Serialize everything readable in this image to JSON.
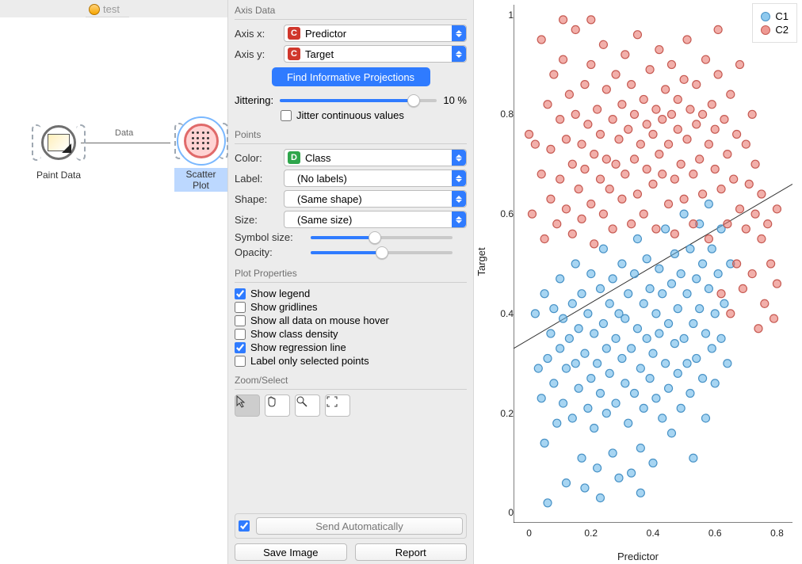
{
  "tab": {
    "title": "test"
  },
  "canvas": {
    "node1_label": "Paint Data",
    "node2_label": "Scatter Plot",
    "edge_label": "Data"
  },
  "panel": {
    "axis_section": "Axis Data",
    "axis_x_label": "Axis x:",
    "axis_x_value": "Predictor",
    "axis_y_label": "Axis y:",
    "axis_y_value": "Target",
    "find_btn": "Find Informative Projections",
    "jitter_label": "Jittering:",
    "jitter_value": "10 %",
    "jitter_cont": "Jitter continuous values",
    "points_section": "Points",
    "color_label": "Color:",
    "color_value": "Class",
    "label_label": "Label:",
    "label_value": "(No labels)",
    "shape_label": "Shape:",
    "shape_value": "(Same shape)",
    "size_label": "Size:",
    "size_value": "(Same size)",
    "symsize_label": "Symbol size:",
    "opacity_label": "Opacity:",
    "plotprops_section": "Plot Properties",
    "p1": "Show legend",
    "p2": "Show gridlines",
    "p3": "Show all data on mouse hover",
    "p4": "Show class density",
    "p5": "Show regression line",
    "p6": "Label only selected points",
    "zoom_section": "Zoom/Select",
    "send_auto": "Send Automatically",
    "save_img": "Save Image",
    "report": "Report"
  },
  "chart_data": {
    "type": "scatter",
    "xlabel": "Predictor",
    "ylabel": "Target",
    "xlim": [
      -0.05,
      0.85
    ],
    "ylim": [
      -0.02,
      1.02
    ],
    "x_ticks": [
      0,
      0.2,
      0.4,
      0.6,
      0.8
    ],
    "y_ticks": [
      0,
      0.2,
      0.4,
      0.6,
      0.8,
      1
    ],
    "legend": [
      "C1",
      "C2"
    ],
    "regression": {
      "x0": -0.05,
      "y0": 0.33,
      "x1": 0.85,
      "y1": 0.66
    },
    "series": [
      {
        "name": "C1",
        "points": [
          [
            0.02,
            0.4
          ],
          [
            0.03,
            0.29
          ],
          [
            0.04,
            0.23
          ],
          [
            0.05,
            0.44
          ],
          [
            0.05,
            0.14
          ],
          [
            0.06,
            0.31
          ],
          [
            0.07,
            0.36
          ],
          [
            0.08,
            0.26
          ],
          [
            0.08,
            0.41
          ],
          [
            0.09,
            0.18
          ],
          [
            0.1,
            0.33
          ],
          [
            0.1,
            0.47
          ],
          [
            0.11,
            0.22
          ],
          [
            0.11,
            0.39
          ],
          [
            0.12,
            0.29
          ],
          [
            0.12,
            0.06
          ],
          [
            0.13,
            0.35
          ],
          [
            0.14,
            0.42
          ],
          [
            0.14,
            0.19
          ],
          [
            0.15,
            0.3
          ],
          [
            0.15,
            0.5
          ],
          [
            0.16,
            0.25
          ],
          [
            0.16,
            0.37
          ],
          [
            0.17,
            0.11
          ],
          [
            0.17,
            0.44
          ],
          [
            0.18,
            0.32
          ],
          [
            0.18,
            0.05
          ],
          [
            0.19,
            0.21
          ],
          [
            0.19,
            0.4
          ],
          [
            0.2,
            0.27
          ],
          [
            0.2,
            0.48
          ],
          [
            0.21,
            0.17
          ],
          [
            0.21,
            0.36
          ],
          [
            0.22,
            0.3
          ],
          [
            0.22,
            0.09
          ],
          [
            0.23,
            0.45
          ],
          [
            0.23,
            0.24
          ],
          [
            0.24,
            0.38
          ],
          [
            0.24,
            0.53
          ],
          [
            0.25,
            0.2
          ],
          [
            0.25,
            0.33
          ],
          [
            0.26,
            0.42
          ],
          [
            0.26,
            0.28
          ],
          [
            0.27,
            0.12
          ],
          [
            0.27,
            0.47
          ],
          [
            0.28,
            0.35
          ],
          [
            0.28,
            0.22
          ],
          [
            0.29,
            0.4
          ],
          [
            0.29,
            0.07
          ],
          [
            0.3,
            0.31
          ],
          [
            0.3,
            0.5
          ],
          [
            0.31,
            0.26
          ],
          [
            0.31,
            0.39
          ],
          [
            0.32,
            0.18
          ],
          [
            0.32,
            0.44
          ],
          [
            0.33,
            0.33
          ],
          [
            0.33,
            0.08
          ],
          [
            0.34,
            0.48
          ],
          [
            0.34,
            0.24
          ],
          [
            0.35,
            0.37
          ],
          [
            0.35,
            0.55
          ],
          [
            0.36,
            0.29
          ],
          [
            0.36,
            0.13
          ],
          [
            0.37,
            0.42
          ],
          [
            0.37,
            0.21
          ],
          [
            0.38,
            0.35
          ],
          [
            0.38,
            0.51
          ],
          [
            0.39,
            0.27
          ],
          [
            0.39,
            0.45
          ],
          [
            0.4,
            0.32
          ],
          [
            0.4,
            0.1
          ],
          [
            0.41,
            0.4
          ],
          [
            0.41,
            0.23
          ],
          [
            0.42,
            0.49
          ],
          [
            0.42,
            0.36
          ],
          [
            0.43,
            0.19
          ],
          [
            0.43,
            0.44
          ],
          [
            0.44,
            0.3
          ],
          [
            0.44,
            0.57
          ],
          [
            0.45,
            0.25
          ],
          [
            0.45,
            0.38
          ],
          [
            0.46,
            0.46
          ],
          [
            0.46,
            0.16
          ],
          [
            0.47,
            0.34
          ],
          [
            0.47,
            0.52
          ],
          [
            0.48,
            0.28
          ],
          [
            0.48,
            0.41
          ],
          [
            0.49,
            0.21
          ],
          [
            0.49,
            0.48
          ],
          [
            0.5,
            0.35
          ],
          [
            0.5,
            0.6
          ],
          [
            0.51,
            0.3
          ],
          [
            0.51,
            0.44
          ],
          [
            0.52,
            0.24
          ],
          [
            0.52,
            0.53
          ],
          [
            0.53,
            0.38
          ],
          [
            0.53,
            0.11
          ],
          [
            0.54,
            0.47
          ],
          [
            0.54,
            0.31
          ],
          [
            0.55,
            0.41
          ],
          [
            0.55,
            0.58
          ],
          [
            0.56,
            0.27
          ],
          [
            0.56,
            0.5
          ],
          [
            0.57,
            0.36
          ],
          [
            0.57,
            0.19
          ],
          [
            0.58,
            0.45
          ],
          [
            0.58,
            0.62
          ],
          [
            0.59,
            0.33
          ],
          [
            0.59,
            0.53
          ],
          [
            0.6,
            0.4
          ],
          [
            0.6,
            0.26
          ],
          [
            0.61,
            0.48
          ],
          [
            0.62,
            0.35
          ],
          [
            0.62,
            0.57
          ],
          [
            0.63,
            0.42
          ],
          [
            0.64,
            0.3
          ],
          [
            0.65,
            0.5
          ],
          [
            0.06,
            0.02
          ],
          [
            0.23,
            0.03
          ],
          [
            0.36,
            0.04
          ]
        ]
      },
      {
        "name": "C2",
        "points": [
          [
            0.0,
            0.76
          ],
          [
            0.01,
            0.6
          ],
          [
            0.02,
            0.74
          ],
          [
            0.04,
            0.68
          ],
          [
            0.04,
            0.95
          ],
          [
            0.05,
            0.55
          ],
          [
            0.06,
            0.82
          ],
          [
            0.07,
            0.63
          ],
          [
            0.07,
            0.73
          ],
          [
            0.08,
            0.88
          ],
          [
            0.09,
            0.58
          ],
          [
            0.1,
            0.79
          ],
          [
            0.1,
            0.67
          ],
          [
            0.11,
            0.91
          ],
          [
            0.12,
            0.61
          ],
          [
            0.12,
            0.75
          ],
          [
            0.13,
            0.84
          ],
          [
            0.14,
            0.56
          ],
          [
            0.14,
            0.7
          ],
          [
            0.15,
            0.8
          ],
          [
            0.15,
            0.97
          ],
          [
            0.16,
            0.65
          ],
          [
            0.17,
            0.74
          ],
          [
            0.17,
            0.59
          ],
          [
            0.18,
            0.86
          ],
          [
            0.18,
            0.69
          ],
          [
            0.19,
            0.78
          ],
          [
            0.2,
            0.62
          ],
          [
            0.2,
            0.9
          ],
          [
            0.21,
            0.72
          ],
          [
            0.21,
            0.54
          ],
          [
            0.22,
            0.81
          ],
          [
            0.23,
            0.67
          ],
          [
            0.23,
            0.76
          ],
          [
            0.24,
            0.94
          ],
          [
            0.24,
            0.6
          ],
          [
            0.25,
            0.71
          ],
          [
            0.25,
            0.85
          ],
          [
            0.26,
            0.65
          ],
          [
            0.27,
            0.79
          ],
          [
            0.27,
            0.57
          ],
          [
            0.28,
            0.88
          ],
          [
            0.28,
            0.7
          ],
          [
            0.29,
            0.75
          ],
          [
            0.3,
            0.63
          ],
          [
            0.3,
            0.82
          ],
          [
            0.31,
            0.92
          ],
          [
            0.31,
            0.68
          ],
          [
            0.32,
            0.77
          ],
          [
            0.33,
            0.58
          ],
          [
            0.33,
            0.86
          ],
          [
            0.34,
            0.71
          ],
          [
            0.34,
            0.8
          ],
          [
            0.35,
            0.64
          ],
          [
            0.35,
            0.96
          ],
          [
            0.36,
            0.74
          ],
          [
            0.37,
            0.83
          ],
          [
            0.37,
            0.6
          ],
          [
            0.38,
            0.78
          ],
          [
            0.38,
            0.69
          ],
          [
            0.39,
            0.89
          ],
          [
            0.4,
            0.66
          ],
          [
            0.4,
            0.76
          ],
          [
            0.41,
            0.81
          ],
          [
            0.41,
            0.57
          ],
          [
            0.42,
            0.72
          ],
          [
            0.42,
            0.93
          ],
          [
            0.43,
            0.68
          ],
          [
            0.43,
            0.79
          ],
          [
            0.44,
            0.85
          ],
          [
            0.45,
            0.62
          ],
          [
            0.45,
            0.74
          ],
          [
            0.46,
            0.8
          ],
          [
            0.46,
            0.9
          ],
          [
            0.47,
            0.67
          ],
          [
            0.47,
            0.56
          ],
          [
            0.48,
            0.77
          ],
          [
            0.48,
            0.83
          ],
          [
            0.49,
            0.7
          ],
          [
            0.5,
            0.87
          ],
          [
            0.5,
            0.63
          ],
          [
            0.51,
            0.75
          ],
          [
            0.51,
            0.95
          ],
          [
            0.52,
            0.81
          ],
          [
            0.53,
            0.68
          ],
          [
            0.53,
            0.58
          ],
          [
            0.54,
            0.78
          ],
          [
            0.54,
            0.86
          ],
          [
            0.55,
            0.71
          ],
          [
            0.56,
            0.64
          ],
          [
            0.56,
            0.8
          ],
          [
            0.57,
            0.91
          ],
          [
            0.58,
            0.74
          ],
          [
            0.58,
            0.55
          ],
          [
            0.59,
            0.82
          ],
          [
            0.6,
            0.69
          ],
          [
            0.6,
            0.77
          ],
          [
            0.61,
            0.88
          ],
          [
            0.62,
            0.65
          ],
          [
            0.62,
            0.44
          ],
          [
            0.63,
            0.79
          ],
          [
            0.64,
            0.72
          ],
          [
            0.64,
            0.58
          ],
          [
            0.65,
            0.84
          ],
          [
            0.65,
            0.4
          ],
          [
            0.66,
            0.67
          ],
          [
            0.67,
            0.76
          ],
          [
            0.67,
            0.5
          ],
          [
            0.68,
            0.61
          ],
          [
            0.68,
            0.9
          ],
          [
            0.69,
            0.45
          ],
          [
            0.7,
            0.74
          ],
          [
            0.7,
            0.57
          ],
          [
            0.71,
            0.66
          ],
          [
            0.72,
            0.8
          ],
          [
            0.72,
            0.48
          ],
          [
            0.73,
            0.6
          ],
          [
            0.73,
            0.7
          ],
          [
            0.74,
            0.37
          ],
          [
            0.75,
            0.55
          ],
          [
            0.75,
            0.64
          ],
          [
            0.76,
            0.42
          ],
          [
            0.77,
            0.58
          ],
          [
            0.78,
            0.5
          ],
          [
            0.79,
            0.39
          ],
          [
            0.8,
            0.61
          ],
          [
            0.8,
            0.46
          ],
          [
            0.2,
            0.99
          ],
          [
            0.61,
            0.97
          ],
          [
            0.11,
            0.99
          ]
        ]
      }
    ]
  }
}
